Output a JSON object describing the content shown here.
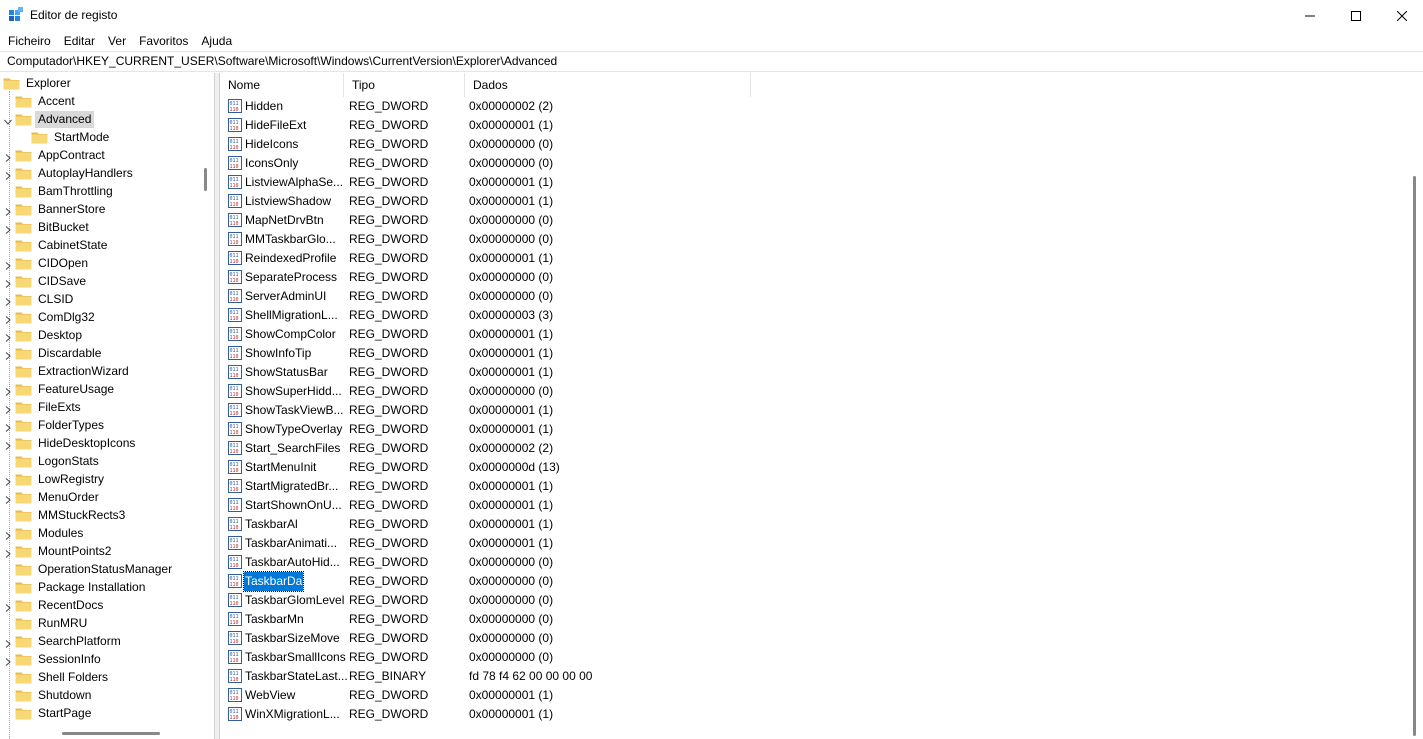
{
  "window": {
    "title": "Editor de registo"
  },
  "menu": [
    "Ficheiro",
    "Editar",
    "Ver",
    "Favoritos",
    "Ajuda"
  ],
  "address": "Computador\\HKEY_CURRENT_USER\\Software\\Microsoft\\Windows\\CurrentVersion\\Explorer\\Advanced",
  "tree": {
    "root": "Explorer",
    "items": [
      {
        "label": "Accent",
        "expandable": false,
        "level": 1
      },
      {
        "label": "Advanced",
        "expandable": true,
        "expanded": true,
        "selected": true,
        "level": 1
      },
      {
        "label": "StartMode",
        "expandable": false,
        "level": 2
      },
      {
        "label": "AppContract",
        "expandable": true,
        "level": 1
      },
      {
        "label": "AutoplayHandlers",
        "expandable": true,
        "level": 1
      },
      {
        "label": "BamThrottling",
        "expandable": false,
        "level": 1
      },
      {
        "label": "BannerStore",
        "expandable": true,
        "level": 1
      },
      {
        "label": "BitBucket",
        "expandable": true,
        "level": 1
      },
      {
        "label": "CabinetState",
        "expandable": false,
        "level": 1
      },
      {
        "label": "CIDOpen",
        "expandable": true,
        "level": 1
      },
      {
        "label": "CIDSave",
        "expandable": true,
        "level": 1
      },
      {
        "label": "CLSID",
        "expandable": true,
        "level": 1
      },
      {
        "label": "ComDlg32",
        "expandable": true,
        "level": 1
      },
      {
        "label": "Desktop",
        "expandable": true,
        "level": 1
      },
      {
        "label": "Discardable",
        "expandable": true,
        "level": 1
      },
      {
        "label": "ExtractionWizard",
        "expandable": false,
        "level": 1
      },
      {
        "label": "FeatureUsage",
        "expandable": true,
        "level": 1
      },
      {
        "label": "FileExts",
        "expandable": true,
        "level": 1
      },
      {
        "label": "FolderTypes",
        "expandable": true,
        "level": 1
      },
      {
        "label": "HideDesktopIcons",
        "expandable": true,
        "level": 1
      },
      {
        "label": "LogonStats",
        "expandable": false,
        "level": 1
      },
      {
        "label": "LowRegistry",
        "expandable": true,
        "level": 1
      },
      {
        "label": "MenuOrder",
        "expandable": true,
        "level": 1
      },
      {
        "label": "MMStuckRects3",
        "expandable": false,
        "level": 1
      },
      {
        "label": "Modules",
        "expandable": true,
        "level": 1
      },
      {
        "label": "MountPoints2",
        "expandable": true,
        "level": 1
      },
      {
        "label": "OperationStatusManager",
        "expandable": false,
        "level": 1
      },
      {
        "label": "Package Installation",
        "expandable": false,
        "level": 1
      },
      {
        "label": "RecentDocs",
        "expandable": true,
        "level": 1
      },
      {
        "label": "RunMRU",
        "expandable": false,
        "level": 1
      },
      {
        "label": "SearchPlatform",
        "expandable": true,
        "level": 1
      },
      {
        "label": "SessionInfo",
        "expandable": true,
        "level": 1
      },
      {
        "label": "Shell Folders",
        "expandable": false,
        "level": 1
      },
      {
        "label": "Shutdown",
        "expandable": false,
        "level": 1
      },
      {
        "label": "StartPage",
        "expandable": false,
        "level": 1
      }
    ]
  },
  "list": {
    "headers": {
      "name": "Nome",
      "type": "Tipo",
      "data": "Dados"
    },
    "rows": [
      {
        "name": "Hidden",
        "type": "REG_DWORD",
        "data": "0x00000002 (2)"
      },
      {
        "name": "HideFileExt",
        "type": "REG_DWORD",
        "data": "0x00000001 (1)"
      },
      {
        "name": "HideIcons",
        "type": "REG_DWORD",
        "data": "0x00000000 (0)"
      },
      {
        "name": "IconsOnly",
        "type": "REG_DWORD",
        "data": "0x00000000 (0)"
      },
      {
        "name": "ListviewAlphaSe...",
        "type": "REG_DWORD",
        "data": "0x00000001 (1)"
      },
      {
        "name": "ListviewShadow",
        "type": "REG_DWORD",
        "data": "0x00000001 (1)"
      },
      {
        "name": "MapNetDrvBtn",
        "type": "REG_DWORD",
        "data": "0x00000000 (0)"
      },
      {
        "name": "MMTaskbarGlo...",
        "type": "REG_DWORD",
        "data": "0x00000000 (0)"
      },
      {
        "name": "ReindexedProfile",
        "type": "REG_DWORD",
        "data": "0x00000001 (1)"
      },
      {
        "name": "SeparateProcess",
        "type": "REG_DWORD",
        "data": "0x00000000 (0)"
      },
      {
        "name": "ServerAdminUI",
        "type": "REG_DWORD",
        "data": "0x00000000 (0)"
      },
      {
        "name": "ShellMigrationL...",
        "type": "REG_DWORD",
        "data": "0x00000003 (3)"
      },
      {
        "name": "ShowCompColor",
        "type": "REG_DWORD",
        "data": "0x00000001 (1)"
      },
      {
        "name": "ShowInfoTip",
        "type": "REG_DWORD",
        "data": "0x00000001 (1)"
      },
      {
        "name": "ShowStatusBar",
        "type": "REG_DWORD",
        "data": "0x00000001 (1)"
      },
      {
        "name": "ShowSuperHidd...",
        "type": "REG_DWORD",
        "data": "0x00000000 (0)"
      },
      {
        "name": "ShowTaskViewB...",
        "type": "REG_DWORD",
        "data": "0x00000001 (1)"
      },
      {
        "name": "ShowTypeOverlay",
        "type": "REG_DWORD",
        "data": "0x00000001 (1)"
      },
      {
        "name": "Start_SearchFiles",
        "type": "REG_DWORD",
        "data": "0x00000002 (2)"
      },
      {
        "name": "StartMenuInit",
        "type": "REG_DWORD",
        "data": "0x0000000d (13)"
      },
      {
        "name": "StartMigratedBr...",
        "type": "REG_DWORD",
        "data": "0x00000001 (1)"
      },
      {
        "name": "StartShownOnU...",
        "type": "REG_DWORD",
        "data": "0x00000001 (1)"
      },
      {
        "name": "TaskbarAl",
        "type": "REG_DWORD",
        "data": "0x00000001 (1)"
      },
      {
        "name": "TaskbarAnimati...",
        "type": "REG_DWORD",
        "data": "0x00000001 (1)"
      },
      {
        "name": "TaskbarAutoHid...",
        "type": "REG_DWORD",
        "data": "0x00000000 (0)"
      },
      {
        "name": "TaskbarDa",
        "type": "REG_DWORD",
        "data": "0x00000000 (0)",
        "selected": true
      },
      {
        "name": "TaskbarGlomLevel",
        "type": "REG_DWORD",
        "data": "0x00000000 (0)"
      },
      {
        "name": "TaskbarMn",
        "type": "REG_DWORD",
        "data": "0x00000000 (0)"
      },
      {
        "name": "TaskbarSizeMove",
        "type": "REG_DWORD",
        "data": "0x00000000 (0)"
      },
      {
        "name": "TaskbarSmallIcons",
        "type": "REG_DWORD",
        "data": "0x00000000 (0)"
      },
      {
        "name": "TaskbarStateLast...",
        "type": "REG_BINARY",
        "data": "fd 78 f4 62 00 00 00 00"
      },
      {
        "name": "WebView",
        "type": "REG_DWORD",
        "data": "0x00000001 (1)"
      },
      {
        "name": "WinXMigrationL...",
        "type": "REG_DWORD",
        "data": "0x00000001 (1)"
      }
    ]
  },
  "colors": {
    "selection": "#0078d7",
    "folder": "#f8d775",
    "folder_dark": "#e8b84a"
  }
}
